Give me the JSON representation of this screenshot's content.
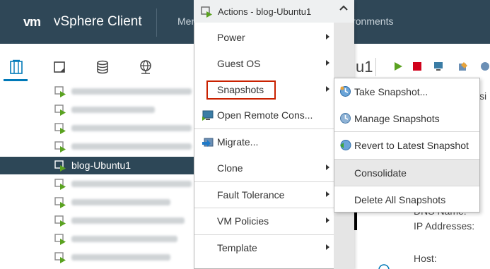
{
  "header": {
    "logo": "vm",
    "app_title": "vSphere Client",
    "menu_label": "Menu",
    "env_fragment": "ironments"
  },
  "left_tabs": [
    {
      "name": "hosts-and-clusters-icon",
      "active": true
    },
    {
      "name": "vms-and-templates-icon",
      "active": false
    },
    {
      "name": "storage-icon",
      "active": false
    },
    {
      "name": "networking-icon",
      "active": false
    }
  ],
  "tree": {
    "selected_label": "blog-Ubuntu1"
  },
  "right_panel": {
    "title_fragment": "u1",
    "partial_label": "si",
    "dns_label": "DNS Name:",
    "ip_label": "IP Addresses:",
    "host_label": "Host:"
  },
  "context_menu": {
    "header": "Actions - blog-Ubuntu1",
    "items": {
      "power": "Power",
      "guest_os": "Guest OS",
      "snapshots": "Snapshots",
      "remote_console": "Open Remote Cons...",
      "migrate": "Migrate...",
      "clone": "Clone",
      "fault_tolerance": "Fault Tolerance",
      "vm_policies": "VM Policies",
      "template": "Template"
    }
  },
  "snapshots_submenu": {
    "take": "Take Snapshot...",
    "manage": "Manage Snapshots",
    "revert": "Revert to Latest Snapshot",
    "consolidate": "Consolidate",
    "delete_all": "Delete All Snapshots"
  },
  "colors": {
    "header_bg": "#2f4757",
    "selected_row_bg": "#2d4757",
    "highlight_border": "#c92100",
    "accent": "#0079b8"
  }
}
